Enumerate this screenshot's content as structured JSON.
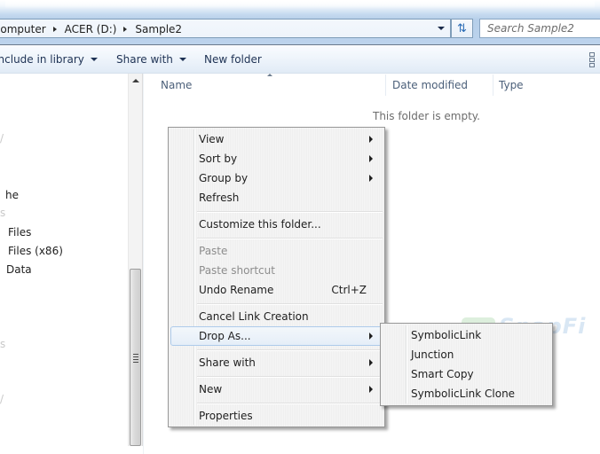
{
  "address_bar": {
    "breadcrumbs": [
      "Computer",
      "ACER (D:)",
      "Sample2"
    ]
  },
  "search": {
    "placeholder": "Search Sample2"
  },
  "toolbar": {
    "include_in_library": "Include in library",
    "share_with": "Share with",
    "new_folder": "New folder"
  },
  "nav_pane": {
    "items": [
      "he",
      "Files",
      "Files (x86)",
      "Data"
    ]
  },
  "content": {
    "columns": [
      "Name",
      "Date modified",
      "Type"
    ],
    "empty_message": "This folder is empty."
  },
  "context_menu": {
    "items": [
      {
        "label": "View",
        "submenu": true
      },
      {
        "label": "Sort by",
        "submenu": true
      },
      {
        "label": "Group by",
        "submenu": true
      },
      {
        "label": "Refresh"
      },
      {
        "label": "Customize this folder..."
      },
      {
        "label": "Paste",
        "disabled": true
      },
      {
        "label": "Paste shortcut",
        "disabled": true
      },
      {
        "label": "Undo Rename",
        "shortcut": "Ctrl+Z"
      },
      {
        "label": "Cancel Link Creation"
      },
      {
        "label": "Drop As...",
        "submenu": true,
        "highlighted": true
      },
      {
        "label": "Share with",
        "submenu": true
      },
      {
        "label": "New",
        "submenu": true
      },
      {
        "label": "Properties"
      }
    ]
  },
  "drop_as_submenu": {
    "items": [
      "SymbolicLink",
      "Junction",
      "Smart Copy",
      "SymbolicLink Clone"
    ]
  },
  "watermark": "SnapFi"
}
